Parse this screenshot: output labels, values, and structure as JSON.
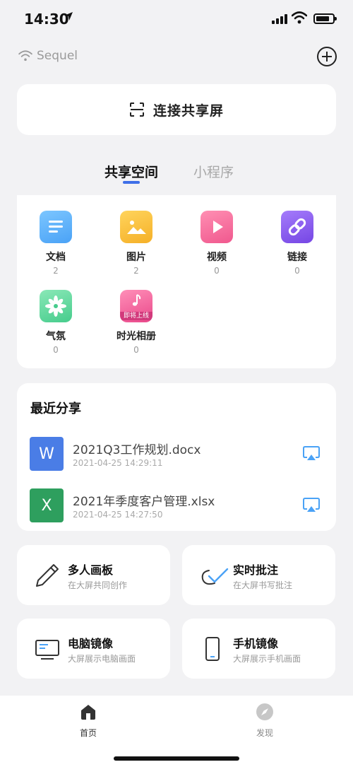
{
  "status": {
    "time": "14:30"
  },
  "header": {
    "network_name": "Sequel"
  },
  "connect": {
    "label": "连接共享屏"
  },
  "tabs": [
    {
      "label": "共享空间",
      "active": true
    },
    {
      "label": "小程序",
      "active": false
    }
  ],
  "space_items": [
    {
      "label": "文档",
      "count": "2",
      "icon": "document-icon"
    },
    {
      "label": "图片",
      "count": "2",
      "icon": "image-icon"
    },
    {
      "label": "视频",
      "count": "0",
      "icon": "video-icon"
    },
    {
      "label": "链接",
      "count": "0",
      "icon": "link-icon"
    },
    {
      "label": "气氛",
      "count": "0",
      "icon": "atmosphere-icon"
    },
    {
      "label": "时光相册",
      "count": "0",
      "icon": "music-album-icon",
      "badge": "即将上线"
    }
  ],
  "recent": {
    "title": "最近分享",
    "files": [
      {
        "icon_letter": "W",
        "name": "2021Q3工作规划.docx",
        "date": "2021-04-25 14:29:11",
        "color": "#4a7de6"
      },
      {
        "icon_letter": "X",
        "name": "2021年季度客户管理.xlsx",
        "date": "2021-04-25 14:27:50",
        "color": "#2e9f5e"
      }
    ]
  },
  "features": [
    {
      "title": "多人画板",
      "subtitle": "在大屏共同创作",
      "icon": "pencil-icon"
    },
    {
      "title": "实时批注",
      "subtitle": "在大屏书写批注",
      "icon": "annotate-check-icon"
    },
    {
      "title": "电脑镜像",
      "subtitle": "大屏展示电脑画面",
      "icon": "monitor-icon"
    },
    {
      "title": "手机镜像",
      "subtitle": "大屏展示手机画面",
      "icon": "phone-icon"
    }
  ],
  "tabbar": [
    {
      "label": "首页",
      "active": true,
      "icon": "home-icon"
    },
    {
      "label": "发现",
      "active": false,
      "icon": "compass-icon"
    }
  ],
  "colors": {
    "accent": "#3f6fe8",
    "background": "#f2f2f4"
  }
}
